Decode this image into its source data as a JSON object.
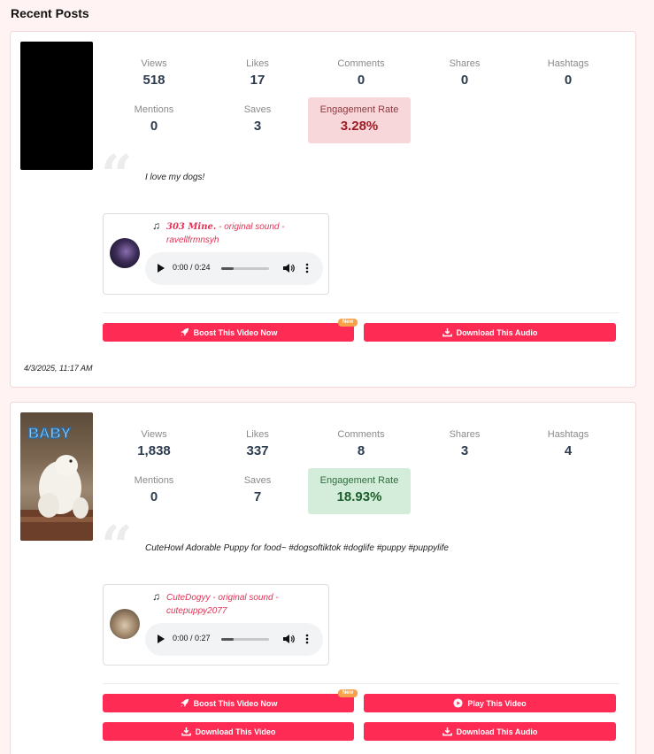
{
  "page": {
    "title": "Recent Posts"
  },
  "posts": [
    {
      "stats": {
        "views": {
          "label": "Views",
          "value": "518"
        },
        "likes": {
          "label": "Likes",
          "value": "17"
        },
        "comments": {
          "label": "Comments",
          "value": "0"
        },
        "shares": {
          "label": "Shares",
          "value": "0"
        },
        "hashtags": {
          "label": "Hashtags",
          "value": "0"
        },
        "mentions": {
          "label": "Mentions",
          "value": "0"
        },
        "saves": {
          "label": "Saves",
          "value": "3"
        },
        "engagement": {
          "label": "Engagement Rate",
          "value": "3.28%"
        }
      },
      "caption": "I love my dogs!",
      "audio": {
        "title": "303 Mine.",
        "subtitle": " - original sound - ravellfrmnsyh",
        "time": "0:00 / 0:24",
        "progress": 0.25
      },
      "buttons": {
        "boost": "Boost This Video Now",
        "download_audio": "Download This Audio",
        "new_badge": "New"
      },
      "date": "4/3/2025, 11:17 AM"
    },
    {
      "stats": {
        "views": {
          "label": "Views",
          "value": "1,838"
        },
        "likes": {
          "label": "Likes",
          "value": "337"
        },
        "comments": {
          "label": "Comments",
          "value": "8"
        },
        "shares": {
          "label": "Shares",
          "value": "3"
        },
        "hashtags": {
          "label": "Hashtags",
          "value": "4"
        },
        "mentions": {
          "label": "Mentions",
          "value": "0"
        },
        "saves": {
          "label": "Saves",
          "value": "7"
        },
        "engagement": {
          "label": "Engagement Rate",
          "value": "18.93%"
        }
      },
      "caption": "CuteHowl Adorable Puppy for food~ #dogsoftiktok #doglife #puppy #puppylife",
      "thumb_text": "BABY",
      "audio": {
        "title": "CuteDogyy",
        "subtitle": " - original sound - cutepuppy2077",
        "time": "0:00 / 0:27",
        "progress": 0.25
      },
      "buttons": {
        "boost": "Boost This Video Now",
        "play_video": "Play This Video",
        "download_video": "Download This Video",
        "download_audio": "Download This Audio",
        "new_badge": "New"
      }
    }
  ],
  "colors": {
    "accent": "#fe2c55",
    "background": "#fff3f3",
    "engagement_low": "#f8d7da",
    "engagement_high": "#d4edda",
    "badge": "#f7a24a"
  },
  "icons": [
    "rocket-icon",
    "download-icon",
    "play-circle-icon",
    "music-note-icon",
    "quote-icon",
    "volume-icon",
    "more-vertical-icon"
  ]
}
